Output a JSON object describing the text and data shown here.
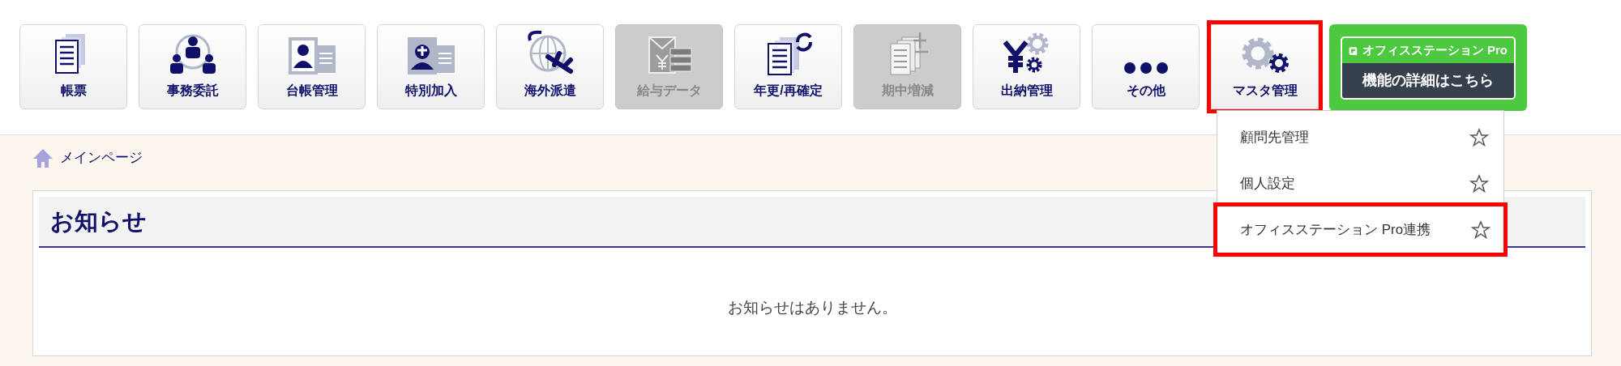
{
  "toolbar": [
    {
      "label": "帳票",
      "disabled": false,
      "highlighted": false
    },
    {
      "label": "事務委託",
      "disabled": false,
      "highlighted": false
    },
    {
      "label": "台帳管理",
      "disabled": false,
      "highlighted": false
    },
    {
      "label": "特別加入",
      "disabled": false,
      "highlighted": false
    },
    {
      "label": "海外派遣",
      "disabled": false,
      "highlighted": false
    },
    {
      "label": "給与データ",
      "disabled": true,
      "highlighted": false
    },
    {
      "label": "年更/再確定",
      "disabled": false,
      "highlighted": false
    },
    {
      "label": "期中増減",
      "disabled": true,
      "highlighted": false
    },
    {
      "label": "出納管理",
      "disabled": false,
      "highlighted": false
    },
    {
      "label": "その他",
      "disabled": false,
      "highlighted": false
    },
    {
      "label": "マスタ管理",
      "disabled": false,
      "highlighted": true
    }
  ],
  "promo": {
    "brand": "オフィスステーション Pro",
    "link": "機能の詳細はこちら"
  },
  "dropdown": [
    {
      "label": "顧問先管理",
      "favorite": false,
      "highlighted": false
    },
    {
      "label": "個人設定",
      "favorite": false,
      "highlighted": false
    },
    {
      "label": "オフィスステーション Pro連携",
      "favorite": false,
      "highlighted": true
    }
  ],
  "breadcrumb": "メインページ",
  "notice": {
    "title": "お知らせ",
    "message": "お知らせはありません。"
  }
}
